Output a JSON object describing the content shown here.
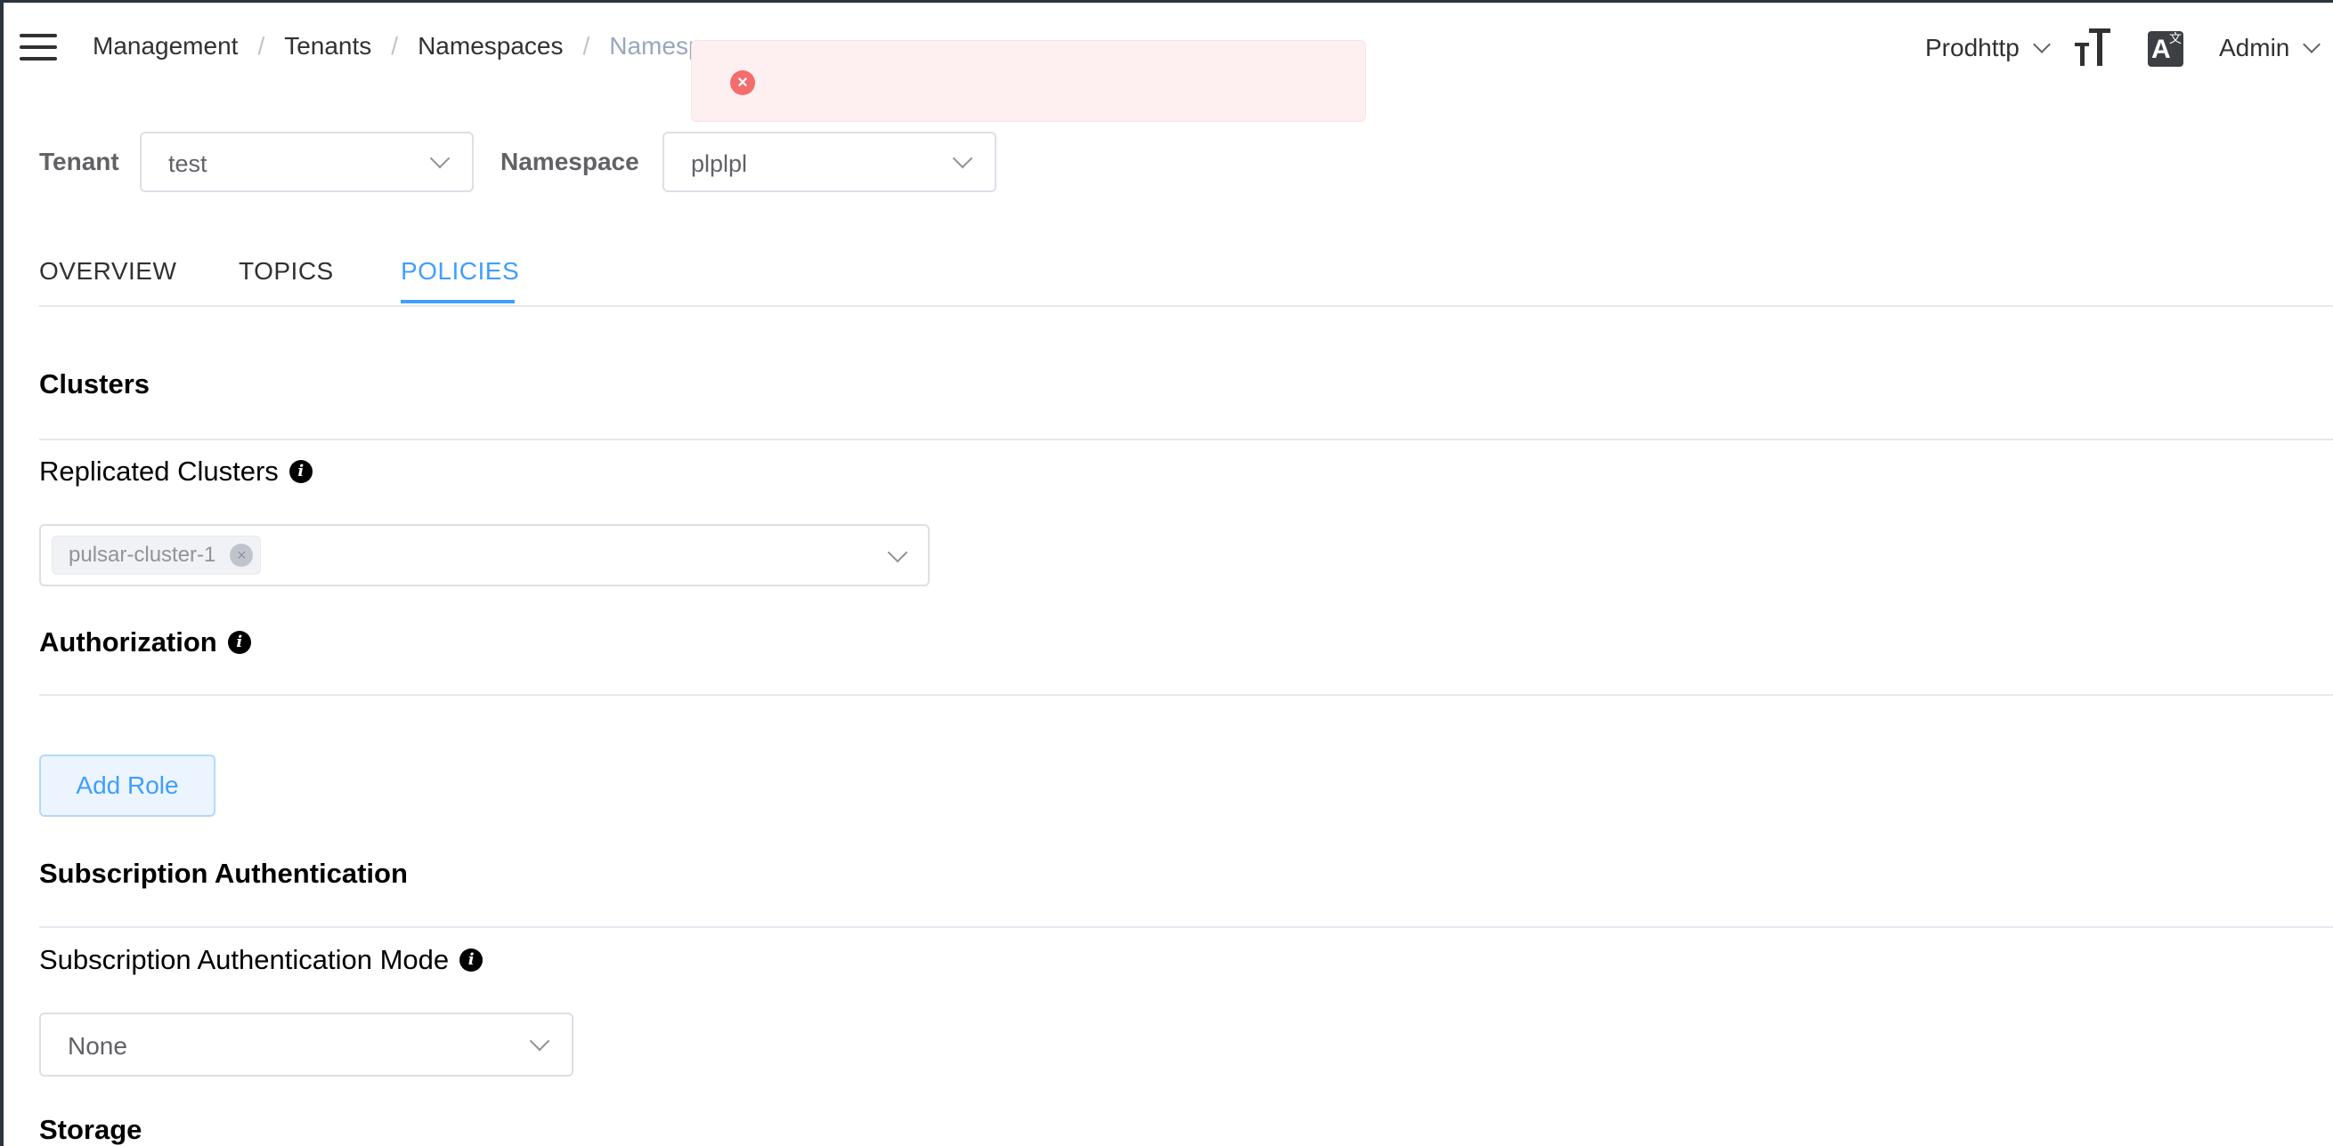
{
  "header": {
    "breadcrumb": [
      "Management",
      "Tenants",
      "Namespaces",
      "Namespa"
    ],
    "environment": "Prodhttp",
    "user": "Admin",
    "language_glyph": "A",
    "language_sub": "文"
  },
  "toast": {
    "type": "error",
    "message": ""
  },
  "filters": {
    "tenant_label": "Tenant",
    "tenant_value": "test",
    "namespace_label": "Namespace",
    "namespace_value": "plplpl"
  },
  "tabs": [
    {
      "label": "OVERVIEW",
      "active": false
    },
    {
      "label": "TOPICS",
      "active": false
    },
    {
      "label": "POLICIES",
      "active": true
    }
  ],
  "clusters": {
    "title": "Clusters",
    "replicated_label": "Replicated Clusters",
    "selected": [
      "pulsar-cluster-1"
    ]
  },
  "authorization": {
    "title": "Authorization",
    "add_role_label": "Add Role"
  },
  "subscription_auth": {
    "title": "Subscription Authentication",
    "mode_label": "Subscription Authentication Mode",
    "mode_value": "None"
  },
  "storage": {
    "title": "Storage"
  },
  "colors": {
    "accent": "#409eff",
    "error": "#f56c6c",
    "error_bg": "#fef0f0"
  }
}
